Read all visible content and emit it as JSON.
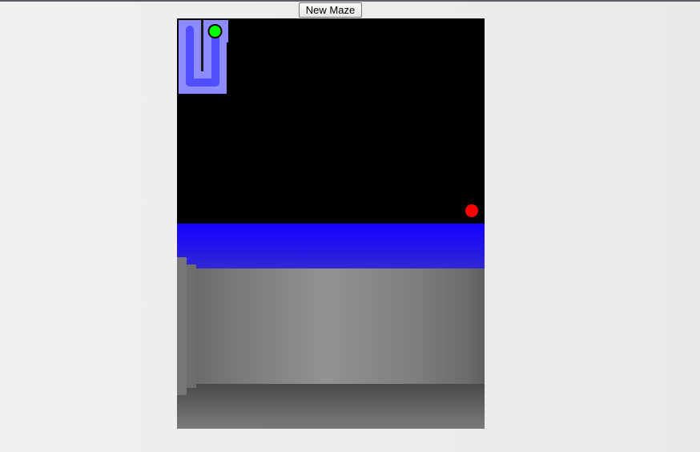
{
  "toolbar": {
    "new_maze_label": "New Maze"
  },
  "game": {
    "sky_color": "#000000",
    "horizon_color": "#1400ff",
    "floor_color": "#5a5a5a",
    "wall_color": "#8f8f8f",
    "minimap": {
      "path_color": "#4f4fff",
      "background_color": "#8c8cff",
      "player_marker_color": "#00ff00"
    },
    "goal_marker_color": "#ff0000"
  }
}
